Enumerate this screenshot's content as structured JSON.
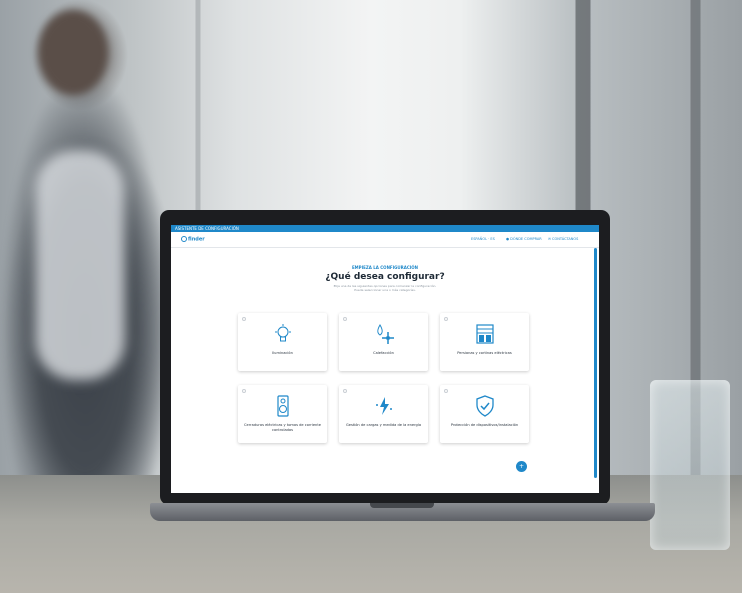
{
  "screen": {
    "topbar_text": "ASISTENTE DE CONFIGURACIÓN",
    "logo_text": "finder",
    "nav": {
      "language": "ESPAÑOL · ES",
      "where_to_buy": "DÓNDE COMPRAR",
      "contact": "CONTÁCTANOS"
    },
    "eyebrow": "EMPIEZA LA CONFIGURACIÓN",
    "title": "¿Qué desea configurar?",
    "subtitle_line1": "Elija una de las siguientes opciones para comenzar la configuración.",
    "subtitle_line2": "Puede seleccionar una o más categorías.",
    "cards": [
      {
        "label": "Iluminación",
        "icon": "lightbulb-icon"
      },
      {
        "label": "Calefacción",
        "icon": "climate-icon"
      },
      {
        "label": "Persianas y cortinas eléctricas",
        "icon": "shutter-icon"
      },
      {
        "label": "Cerraduras eléctricas y tomas de corriente controladas",
        "icon": "speaker-icon"
      },
      {
        "label": "Gestión de cargas y medida de la energía",
        "icon": "energy-icon"
      },
      {
        "label": "Protección de dispositivos/instalación",
        "icon": "shield-icon"
      }
    ],
    "fab_symbol": "+"
  },
  "colors": {
    "accent": "#1f88c9",
    "title": "#1e2a36"
  }
}
